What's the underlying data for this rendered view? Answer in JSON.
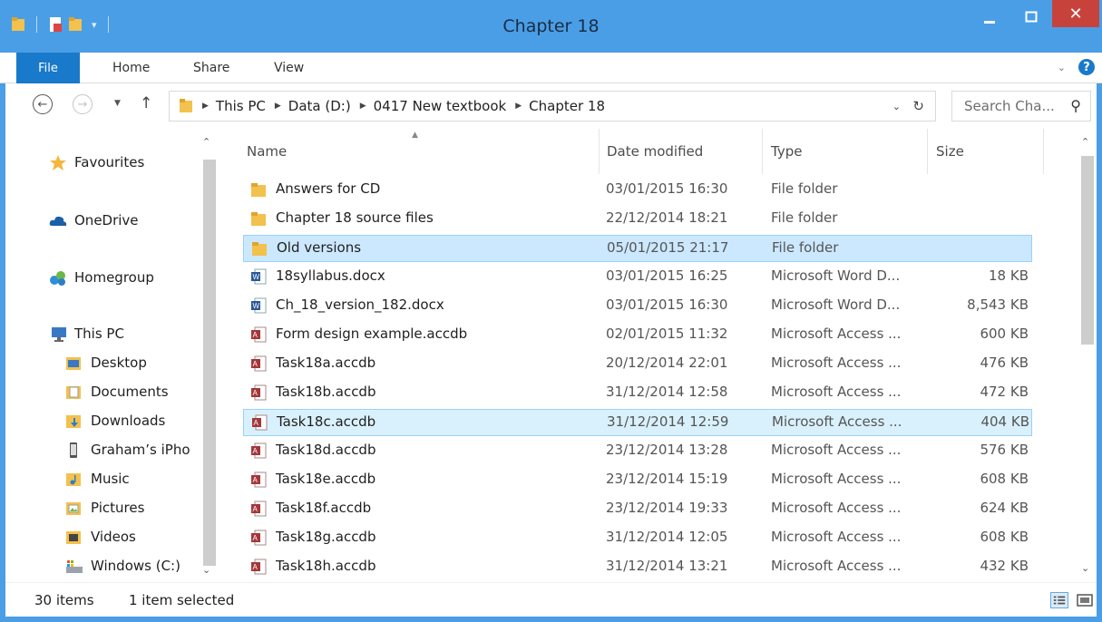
{
  "window": {
    "title": "Chapter 18"
  },
  "ribbon": {
    "tabs": [
      {
        "label": "File"
      },
      {
        "label": "Home"
      },
      {
        "label": "Share"
      },
      {
        "label": "View"
      }
    ]
  },
  "address": {
    "crumbs": [
      "This PC",
      "Data (D:)",
      "0417 New textbook",
      "Chapter 18"
    ],
    "search_placeholder": "Search Cha..."
  },
  "nav": {
    "items": [
      {
        "label": "Favourites",
        "icon": "star-icon"
      },
      {
        "label": "OneDrive",
        "icon": "cloud-icon"
      },
      {
        "label": "Homegroup",
        "icon": "homegroup-icon"
      },
      {
        "label": "This PC",
        "icon": "computer-icon"
      },
      {
        "label": "Desktop",
        "icon": "desktop-folder-icon"
      },
      {
        "label": "Documents",
        "icon": "documents-folder-icon"
      },
      {
        "label": "Downloads",
        "icon": "downloads-folder-icon"
      },
      {
        "label": "Graham’s iPho",
        "icon": "phone-icon"
      },
      {
        "label": "Music",
        "icon": "music-folder-icon"
      },
      {
        "label": "Pictures",
        "icon": "pictures-folder-icon"
      },
      {
        "label": "Videos",
        "icon": "videos-folder-icon"
      },
      {
        "label": "Windows (C:)",
        "icon": "drive-icon"
      }
    ]
  },
  "columns": {
    "name": "Name",
    "date": "Date modified",
    "type": "Type",
    "size": "Size"
  },
  "files": [
    {
      "name": "Answers for CD",
      "date": "03/01/2015 16:30",
      "type": "File folder",
      "size": "",
      "icon": "folder-icon",
      "state": ""
    },
    {
      "name": "Chapter 18 source files",
      "date": "22/12/2014 18:21",
      "type": "File folder",
      "size": "",
      "icon": "folder-icon",
      "state": ""
    },
    {
      "name": "Old versions",
      "date": "05/01/2015 21:17",
      "type": "File folder",
      "size": "",
      "icon": "folder-icon",
      "state": "selected"
    },
    {
      "name": "18syllabus.docx",
      "date": "03/01/2015 16:25",
      "type": "Microsoft Word D...",
      "size": "18 KB",
      "icon": "word-doc-icon",
      "state": ""
    },
    {
      "name": "Ch_18_version_182.docx",
      "date": "03/01/2015 16:30",
      "type": "Microsoft Word D...",
      "size": "8,543 KB",
      "icon": "word-doc-icon",
      "state": ""
    },
    {
      "name": "Form design example.accdb",
      "date": "02/01/2015 11:32",
      "type": "Microsoft Access ...",
      "size": "600 KB",
      "icon": "access-db-icon",
      "state": ""
    },
    {
      "name": "Task18a.accdb",
      "date": "20/12/2014 22:01",
      "type": "Microsoft Access ...",
      "size": "476 KB",
      "icon": "access-db-icon",
      "state": ""
    },
    {
      "name": "Task18b.accdb",
      "date": "31/12/2014 12:58",
      "type": "Microsoft Access ...",
      "size": "472 KB",
      "icon": "access-db-icon",
      "state": ""
    },
    {
      "name": "Task18c.accdb",
      "date": "31/12/2014 12:59",
      "type": "Microsoft Access ...",
      "size": "404 KB",
      "icon": "access-db-icon",
      "state": "focused"
    },
    {
      "name": "Task18d.accdb",
      "date": "23/12/2014 13:28",
      "type": "Microsoft Access ...",
      "size": "576 KB",
      "icon": "access-db-icon",
      "state": ""
    },
    {
      "name": "Task18e.accdb",
      "date": "23/12/2014 15:19",
      "type": "Microsoft Access ...",
      "size": "608 KB",
      "icon": "access-db-icon",
      "state": ""
    },
    {
      "name": "Task18f.accdb",
      "date": "23/12/2014 19:33",
      "type": "Microsoft Access ...",
      "size": "624 KB",
      "icon": "access-db-icon",
      "state": ""
    },
    {
      "name": "Task18g.accdb",
      "date": "31/12/2014 12:05",
      "type": "Microsoft Access ...",
      "size": "608 KB",
      "icon": "access-db-icon",
      "state": ""
    },
    {
      "name": "Task18h.accdb",
      "date": "31/12/2014 13:21",
      "type": "Microsoft Access ...",
      "size": "432 KB",
      "icon": "access-db-icon",
      "state": ""
    }
  ],
  "status": {
    "count": "30 items",
    "selection": "1 item selected"
  },
  "colors": {
    "accent": "#4a9ee6",
    "file_tab": "#1979ca",
    "close": "#c8423c",
    "selection": "#cce8ff"
  }
}
